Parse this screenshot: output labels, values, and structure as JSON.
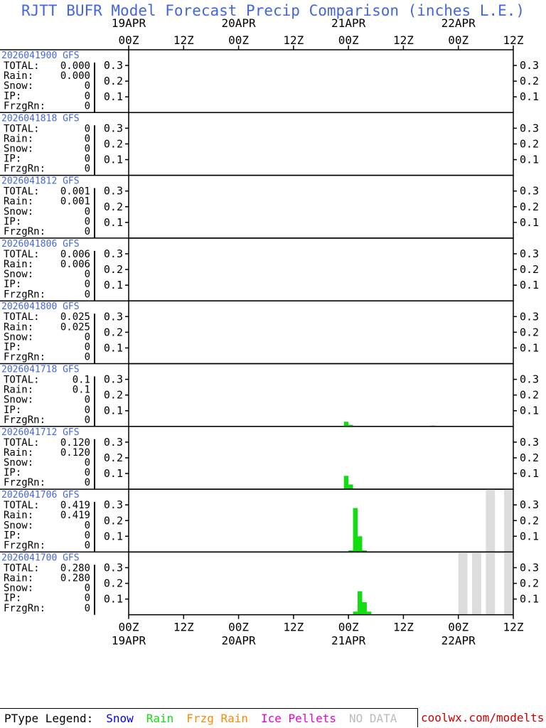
{
  "title": "RJTT BUFR Model Forecast Precip Comparison (inches L.E.)",
  "colors": {
    "title": "#4466dd",
    "rain": "#11dd11",
    "nodata": "#dddddd",
    "snow": "#0000ff",
    "frzg": "#ff8800",
    "ice": "#ee00cc",
    "site": "#cc0000"
  },
  "axis": {
    "time_ticks": [
      "00Z",
      "12Z",
      "00Z",
      "12Z",
      "00Z",
      "12Z",
      "00Z",
      "12Z"
    ],
    "date_labels": [
      "19APR",
      "20APR",
      "21APR",
      "22APR"
    ],
    "hours_span": 84,
    "y_ticks": [
      "0.1",
      "0.2",
      "0.3"
    ]
  },
  "stat_labels": {
    "total": "TOTAL:",
    "rain": "Rain:",
    "snow": "Snow:",
    "ip": "IP:",
    "frzg": "FrzgRn:"
  },
  "legend": {
    "label": "PType Legend:",
    "snow": "Snow",
    "rain": "Rain",
    "frzg": "Frzg Rain",
    "ice": "Ice Pellets",
    "nodata": "NO DATA",
    "site": "coolwx.com/modelts"
  },
  "chart_data": {
    "type": "bar",
    "title": "RJTT BUFR Model Forecast Precip Comparison (inches L.E.)",
    "ylim": [
      0,
      0.4
    ],
    "x_unit": "hours after 19APR 00Z",
    "series": [
      {
        "name": "2026041900 GFS",
        "total": "0.000",
        "rain": "0.000",
        "snow": "0",
        "ip": "0",
        "frzg": "0",
        "bars": [],
        "nodata": []
      },
      {
        "name": "2026041818 GFS",
        "total": "0",
        "rain": "0",
        "snow": "0",
        "ip": "0",
        "frzg": "0",
        "bars": [],
        "nodata": []
      },
      {
        "name": "2026041812 GFS",
        "total": "0.001",
        "rain": "0.001",
        "snow": "0",
        "ip": "0",
        "frzg": "0",
        "bars": [],
        "nodata": []
      },
      {
        "name": "2026041806 GFS",
        "total": "0.006",
        "rain": "0.006",
        "snow": "0",
        "ip": "0",
        "frzg": "0",
        "bars": [],
        "nodata": []
      },
      {
        "name": "2026041800 GFS",
        "total": "0.025",
        "rain": "0.025",
        "snow": "0",
        "ip": "0",
        "frzg": "0",
        "bars": [],
        "nodata": []
      },
      {
        "name": "2026041718 GFS",
        "total": "0.1",
        "rain": "0.1",
        "snow": "0",
        "ip": "0",
        "frzg": "0",
        "bars": [
          {
            "x": 47,
            "v": 0.03
          },
          {
            "x": 48,
            "v": 0.01
          },
          {
            "x": 66,
            "v": 0.005
          }
        ],
        "nodata": []
      },
      {
        "name": "2026041712 GFS",
        "total": "0.120",
        "rain": "0.120",
        "snow": "0",
        "ip": "0",
        "frzg": "0",
        "bars": [
          {
            "x": 47,
            "v": 0.085
          },
          {
            "x": 48,
            "v": 0.03
          }
        ],
        "nodata": []
      },
      {
        "name": "2026041706 GFS",
        "total": "0.419",
        "rain": "0.419",
        "snow": "0",
        "ip": "0",
        "frzg": "0",
        "bars": [
          {
            "x": 48,
            "v": 0.01
          },
          {
            "x": 49,
            "v": 0.28
          },
          {
            "x": 50,
            "v": 0.1
          },
          {
            "x": 51,
            "v": 0.01
          }
        ],
        "nodata": [
          [
            78,
            80
          ],
          [
            82,
            84
          ]
        ]
      },
      {
        "name": "2026041700 GFS",
        "total": "0.280",
        "rain": "0.280",
        "snow": "0",
        "ip": "0",
        "frzg": "0",
        "bars": [
          {
            "x": 49,
            "v": 0.02
          },
          {
            "x": 50,
            "v": 0.15
          },
          {
            "x": 51,
            "v": 0.08
          },
          {
            "x": 52,
            "v": 0.02
          }
        ],
        "nodata": [
          [
            72,
            74
          ],
          [
            75,
            77
          ],
          [
            78,
            80
          ],
          [
            82,
            84
          ]
        ]
      }
    ]
  }
}
